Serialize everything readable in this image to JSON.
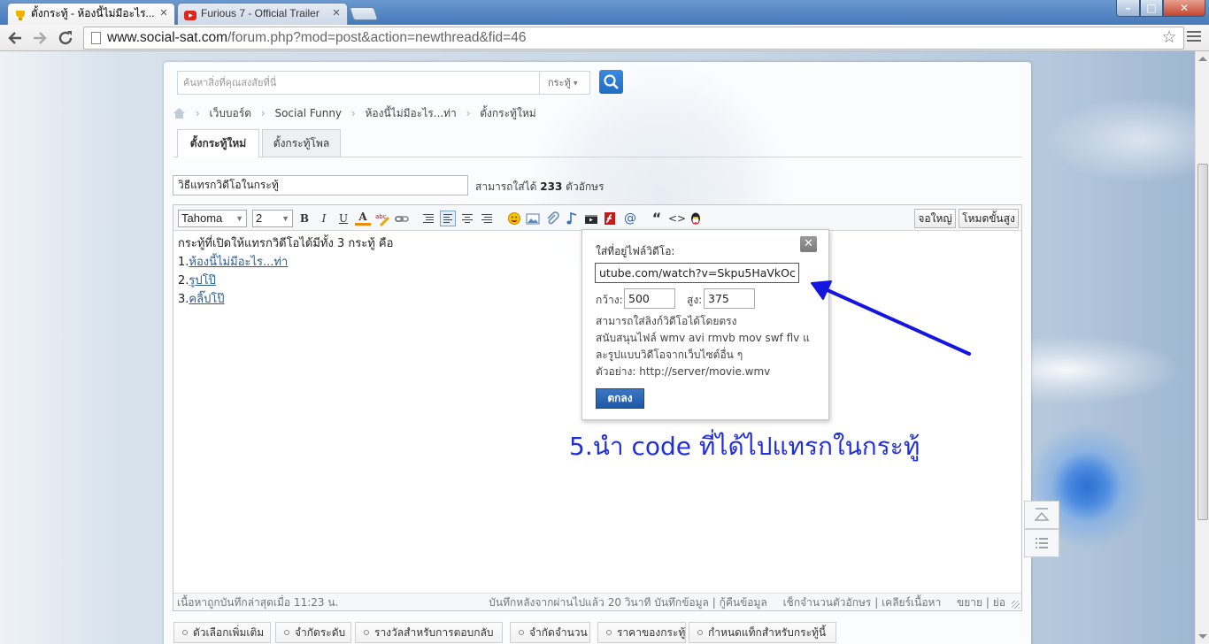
{
  "browser": {
    "tabs": [
      {
        "title": "ตั้งกระทู้ - ห้องนี้ไม่มีอะไร...ท่า",
        "active": true
      },
      {
        "title": "Furious 7 - Official Trailer",
        "active": false
      }
    ],
    "url_host": "www.social-sat.com",
    "url_path": "/forum.php?mod=post&action=newthread&fid=46",
    "window_controls": {
      "minimize": "–",
      "maximize": "□",
      "close": "✕"
    }
  },
  "search": {
    "placeholder": "ค้นหาสิ่งที่คุณสงสัยที่นี่",
    "type_label": "กระทู้",
    "type_caret": "▾"
  },
  "breadcrumb": {
    "separator": "›",
    "items": [
      "เว็บบอร์ด",
      "Social Funny",
      "ห้องนี้ไม่มีอะไร...ท่า",
      "ตั้งกระทู้ใหม่"
    ]
  },
  "post_tabs": [
    "ตั้งกระทู้ใหม่",
    "ตั้งกระทู้โพล"
  ],
  "title_field": {
    "value": "วิธีแทรกวิดีโอในกระทู้",
    "limit_prefix": "สามารถใส่ได้",
    "limit_count": "233",
    "limit_suffix": "ตัวอักษร"
  },
  "toolbar": {
    "font": "Tahoma",
    "size": "2",
    "bold": "B",
    "italic": "I",
    "underline": "U",
    "font_color": "A",
    "fullscreen": "จอใหญ่",
    "advanced": "โหมดขั้นสูง",
    "icons": [
      "highlight-icon",
      "link-icon",
      "list-icon",
      "align-left-icon",
      "align-center-icon",
      "align-right-icon",
      "smiley-icon",
      "image-icon",
      "attachment-icon",
      "music-icon",
      "video-icon",
      "flash-icon",
      "at-icon",
      "quote-icon",
      "code-icon",
      "qq-icon"
    ]
  },
  "content": {
    "intro": "กระทู้ที่เปิดให้แทรกวิดีโอได้มีทั้ง 3 กระทู้ คือ",
    "items": [
      {
        "num": "1.",
        "link": "ห้องนี้ไม่มีอะไร...ท่า"
      },
      {
        "num": "2.",
        "link": "รูปโป๊"
      },
      {
        "num": "3.",
        "link": "คลิ๊ปโป๊"
      }
    ]
  },
  "video_dialog": {
    "label": "ใส่ที่อยู่ไฟล์วิดีโอ:",
    "url": "utube.com/watch?v=Skpu5HaVkOc",
    "width_label": "กว้าง:",
    "width": "500",
    "height_label": "สูง:",
    "height": "375",
    "help": [
      "สามารถใส่ลิงก์วิดีโอได้โดยตรง",
      "สนับสนุนไฟล์ wmv avi rmvb mov swf flv แ",
      "ละรูปแบบวิดีโอจากเว็บไซต์อื่น ๆ",
      "ตัวอย่าง: http://server/movie.wmv"
    ],
    "ok": "ตกลง"
  },
  "annotation": "5.นำ code ที่ได้ไปแทรกในกระทู้",
  "status_bar": {
    "saved": "เนื้อหาถูกบันทึกล่าสุดเมื่อ 11:23 น.",
    "autosave": "บันทึกหลังจากผ่านไปแล้ว 20 วินาที",
    "save": "บันทึกข้อมูล",
    "restore": "กู้คืนข้อมูล",
    "check_length": "เช็กจำนวนตัวอักษร",
    "clear": "เคลียร์เนื้อหา",
    "expand": "ขยาย",
    "shrink": "ย่อ",
    "divider": "|"
  },
  "options": [
    "ตัวเลือกเพิ่มเติม",
    "จำกัดระดับ",
    "รางวัลสำหรับการตอบกลับ",
    "จำกัดจำนวน",
    "ราคาของกระทู้",
    "กำหนดแท็กสำหรับกระทู้นี้"
  ],
  "colors": {
    "accent": "#1f6cc3",
    "annotation": "#1f2fe0",
    "arrow": "#1515e0",
    "link": "#2c5b92"
  }
}
